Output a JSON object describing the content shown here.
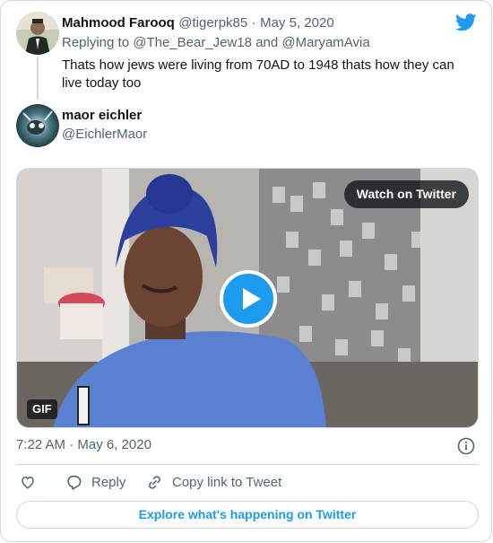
{
  "reply_tweet": {
    "author_name": "Mahmood Farooq",
    "author_handle": "@tigerpk85",
    "separator": "·",
    "date": "May 5, 2020",
    "replying_to_prefix": "Replying to",
    "mention_1": "@The_Bear_Jew18",
    "and_word": "and",
    "mention_2": "@MaryamAvia",
    "text": "Thats how jews were living from 70AD to 1948 thats how they can live today too"
  },
  "main_tweet": {
    "author_name": "maor eichler",
    "author_handle": "@EichlerMaor",
    "media": {
      "watch_label": "Watch on Twitter",
      "gif_label": "GIF"
    },
    "timestamp": "7:22 AM · May 6, 2020"
  },
  "actions": {
    "reply_label": "Reply",
    "copy_link_label": "Copy link to Tweet",
    "explore_label": "Explore what's happening on Twitter"
  },
  "colors": {
    "twitter_blue": "#1d9bf0",
    "text_secondary": "#536471",
    "border": "#cfd9de"
  },
  "icons": [
    "twitter-bird-icon",
    "play-icon",
    "info-icon",
    "heart-icon",
    "reply-icon",
    "link-icon"
  ]
}
